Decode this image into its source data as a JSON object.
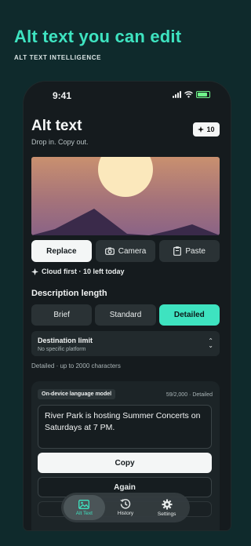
{
  "promo": {
    "title": "Alt text you can edit",
    "subtitle": "ALT TEXT INTELLIGENCE"
  },
  "status_bar": {
    "time": "9:41"
  },
  "header": {
    "title": "Alt text",
    "subtitle": "Drop in. Copy out.",
    "credits": "10"
  },
  "image_actions": {
    "replace": "Replace",
    "camera": "Camera",
    "paste": "Paste"
  },
  "cloud_info": "Cloud first · 10 left today",
  "description_length": {
    "label": "Description length",
    "options": [
      "Brief",
      "Standard",
      "Detailed"
    ],
    "selected": "Detailed"
  },
  "destination": {
    "label": "Destination limit",
    "value": "No specific platform"
  },
  "limit_info": "Detailed · up to 2000 characters",
  "result": {
    "model": "On-device language model",
    "count": "59/2,000 · Detailed",
    "text": "River Park is hosting Summer Concerts on Saturdays at 7 PM.",
    "copy": "Copy",
    "again": "Again"
  },
  "tabs": [
    {
      "label": "Alt Text",
      "icon": "image-icon",
      "active": true
    },
    {
      "label": "History",
      "icon": "history-icon",
      "active": false
    },
    {
      "label": "Settings",
      "icon": "gear-icon",
      "active": false
    }
  ],
  "colors": {
    "accent": "#3ee3c0",
    "background": "#0f2a2c",
    "surface": "#151b1e"
  }
}
